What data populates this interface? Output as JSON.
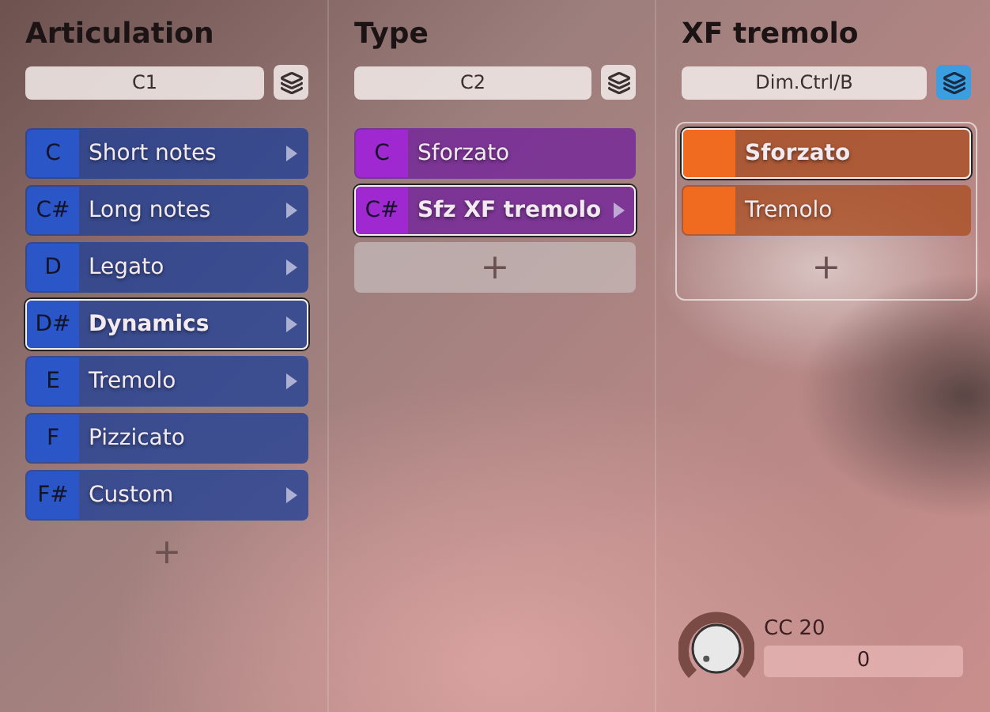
{
  "columns": [
    {
      "title": "Articulation",
      "field": "C1",
      "layers_active": false,
      "color": "#2a56c8",
      "grouped": false,
      "add_filled": false,
      "items": [
        {
          "key": "C",
          "label": "Short notes",
          "submenu": true,
          "selected": false
        },
        {
          "key": "C#",
          "label": "Long notes",
          "submenu": true,
          "selected": false
        },
        {
          "key": "D",
          "label": "Legato",
          "submenu": true,
          "selected": false
        },
        {
          "key": "D#",
          "label": "Dynamics",
          "submenu": true,
          "selected": true
        },
        {
          "key": "E",
          "label": "Tremolo",
          "submenu": true,
          "selected": false
        },
        {
          "key": "F",
          "label": "Pizzicato",
          "submenu": false,
          "selected": false
        },
        {
          "key": "F#",
          "label": "Custom",
          "submenu": true,
          "selected": false
        }
      ],
      "add": "+"
    },
    {
      "title": "Type",
      "field": "C2",
      "layers_active": false,
      "color": "#a028d0",
      "grouped": false,
      "add_filled": true,
      "items": [
        {
          "key": "C",
          "label": "Sforzato",
          "submenu": false,
          "selected": false
        },
        {
          "key": "C#",
          "label": "Sfz XF tremolo",
          "submenu": true,
          "selected": true
        }
      ],
      "add": "+"
    },
    {
      "title": "XF tremolo",
      "field": "Dim.Ctrl/B",
      "layers_active": true,
      "color": "#f06a20",
      "grouped": true,
      "add_filled": false,
      "items": [
        {
          "label": "Sforzato",
          "submenu": false,
          "selected": true
        },
        {
          "label": "Tremolo",
          "submenu": false,
          "selected": false
        }
      ],
      "add": "+"
    }
  ],
  "controller": {
    "label": "CC 20",
    "value": "0"
  }
}
